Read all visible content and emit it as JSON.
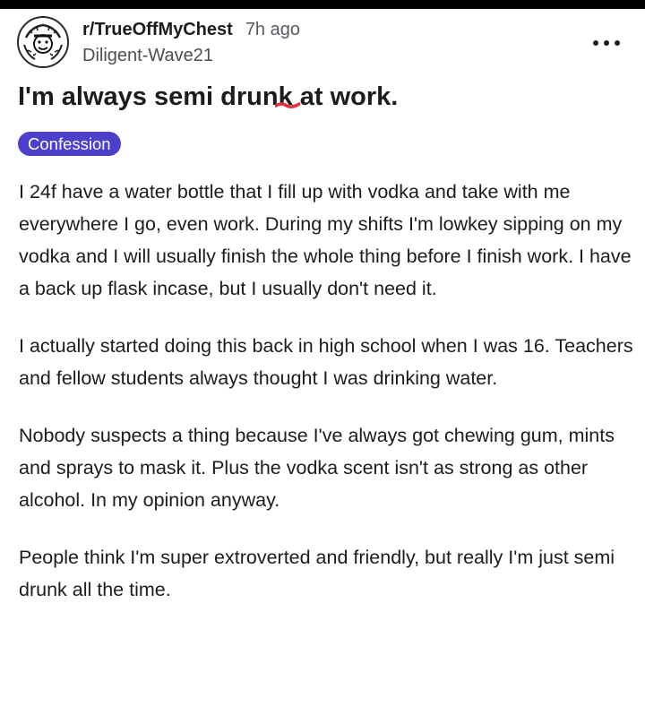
{
  "post": {
    "subreddit": "r/TrueOffMyChest",
    "time_ago": "7h ago",
    "username": "Diligent-Wave21",
    "title": "I'm always semi drunk at work.",
    "flair": "Confession",
    "paragraphs": [
      "I 24f have a water bottle that I fill up with vodka and take with me everywhere I go, even work. During my shifts I'm lowkey sipping on my vodka and I will usually finish the whole thing before I finish work. I have a back up flask incase, but I usually don't need it.",
      "I actually started doing this back in high school when I was 16. Teachers and fellow students always thought I was drinking water.",
      "Nobody suspects a thing because I've always got chewing gum, mints and sprays to mask it. Plus the vodka scent isn't as strong as other alcohol. In my opinion anyway.",
      "People think I'm super extroverted and friendly, but really I'm just semi drunk all the time."
    ]
  },
  "icons": {
    "avatar": "subreddit-avatar-icon",
    "more": "more-options-icon"
  },
  "colors": {
    "flair_bg": "#4b3fcb",
    "flair_text": "#ffffff",
    "text": "#1c1c1c",
    "muted": "#555b60",
    "red_mark": "#e0303a"
  }
}
